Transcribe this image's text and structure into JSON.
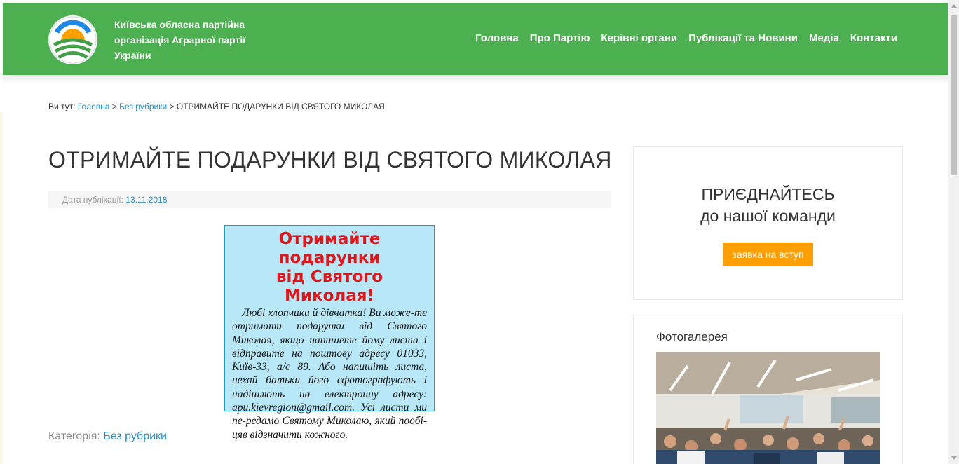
{
  "header": {
    "site_title": "Київська обласна партійна організація Аграрної партії України",
    "logo_icon": "party-sun-logo-icon",
    "nav": [
      "Головна",
      "Про Партію",
      "Керівні органи",
      "Публікації та Новини",
      "Медіа",
      "Контакти"
    ]
  },
  "breadcrumb": {
    "prefix": "Ви тут:",
    "items": [
      "Головна",
      "Без рубрики"
    ],
    "separator": ">",
    "current": "ОТРИМАЙТЕ ПОДАРУНКИ ВІД СВЯТОГО МИКОЛАЯ"
  },
  "post": {
    "title": "ОТРИМАЙТЕ ПОДАРУНКИ ВІД СВЯТОГО МИКОЛАЯ",
    "date_label": "Дата публікації:",
    "date": "13.11.2018",
    "poster": {
      "heading_line1": "Отримайте подарунки",
      "heading_line2": "від Святого Миколая!",
      "body": "Любі хлопчики й дівчатка! Ви може-те отримати подарунки від Святого Миколая, якщо напишете йому листа і відправите на поштову адресу 01033, Київ-33, а/с 89. Або напишіть листа, нехай батьки його сфотографують і надішлють на електронну адресу: apu.kievregion@gmail.com. Усі листи ми пе-редамо Святому Миколаю, який пообі-цяв відзначити кожного."
    },
    "category_label": "Категорія:",
    "category": "Без рубрики"
  },
  "sidebar": {
    "join": {
      "title_line1": "ПРИЄДНАЙТЕСЬ",
      "title_line2": "до нашої команди",
      "button": "заявка на вступ"
    },
    "gallery": {
      "title": "Фотогалерея"
    }
  },
  "colors": {
    "header_green": "#4caf50",
    "link_blue": "#2a8fc2",
    "button_orange": "#ffa000",
    "poster_bg": "#b8e8f8",
    "poster_red": "#e0161b"
  }
}
